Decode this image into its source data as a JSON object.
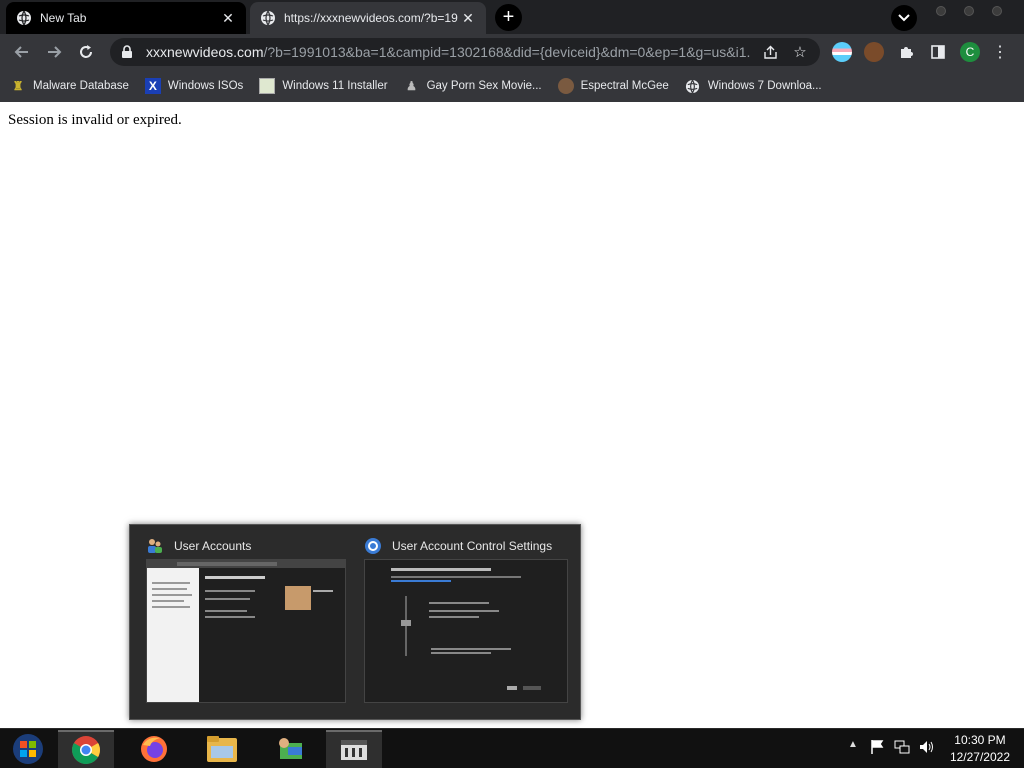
{
  "tabs": [
    {
      "title": "New Tab",
      "active": false
    },
    {
      "title": "https://xxxnewvideos.com/?b=19",
      "active": true
    }
  ],
  "address_bar": {
    "host": "xxxnewvideos.com",
    "path": "/?b=1991013&ba=1&campid=1302168&did={deviceid}&dm=0&ep=1&g=us&i1..."
  },
  "bookmarks": [
    {
      "label": "Malware Database",
      "icon": "malware-db-icon"
    },
    {
      "label": "Windows ISOs",
      "icon": "x-icon"
    },
    {
      "label": "Windows 11 Installer",
      "icon": "image-icon"
    },
    {
      "label": "Gay Porn Sex Movie...",
      "icon": "site-icon"
    },
    {
      "label": "Espectral McGee",
      "icon": "avatar-icon"
    },
    {
      "label": "Windows 7 Downloa...",
      "icon": "globe-icon"
    }
  ],
  "page": {
    "message": "Session is invalid or expired."
  },
  "taskbar_preview": {
    "windows": [
      {
        "title": "User Accounts",
        "icon": "users-icon"
      },
      {
        "title": "User Account Control Settings",
        "icon": "uac-shield-icon"
      }
    ]
  },
  "taskbar": {
    "apps": [
      "start-orb-icon",
      "chrome-icon",
      "firefox-icon",
      "file-explorer-icon",
      "control-panel-icon",
      "uac-settings-icon"
    ],
    "time": "10:30 PM",
    "date": "12/27/2022"
  },
  "profile_initial": "C",
  "colors": {
    "chrome_dark": "#202124",
    "toolbar": "#35363a",
    "profile": "#1e8e3e"
  }
}
